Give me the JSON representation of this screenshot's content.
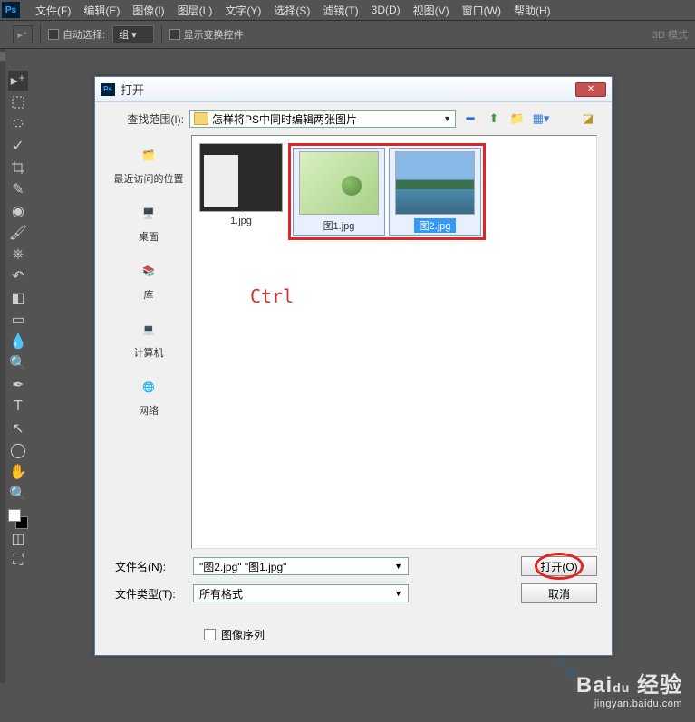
{
  "menubar": {
    "items": [
      "文件(F)",
      "编辑(E)",
      "图像(I)",
      "图层(L)",
      "文字(Y)",
      "选择(S)",
      "滤镜(T)",
      "3D(D)",
      "视图(V)",
      "窗口(W)",
      "帮助(H)"
    ]
  },
  "optionsbar": {
    "autoSelectLabel": "自动选择:",
    "autoSelectValue": "组",
    "showTransformLabel": "显示变换控件",
    "mode3d": "3D 模式"
  },
  "dialog": {
    "title": "打开",
    "lookInLabel": "查找范围(I):",
    "lookInValue": "怎样将PS中同时编辑两张图片",
    "places": {
      "recent": "最近访问的位置",
      "desktop": "桌面",
      "libraries": "库",
      "computer": "计算机",
      "network": "网络"
    },
    "files": {
      "item0": "1.jpg",
      "item1": "图1.jpg",
      "item2": "图2.jpg"
    },
    "hint": "Ctrl",
    "filenameLabel": "文件名(N):",
    "filenameValue": "\"图2.jpg\" \"图1.jpg\"",
    "filetypeLabel": "文件类型(T):",
    "filetypeValue": "所有格式",
    "openBtn": "打开(O)",
    "cancelBtn": "取消",
    "imageSequence": "图像序列"
  },
  "watermark": {
    "brand": "Bai",
    "du": "du",
    "suffix": "经验",
    "url": "jingyan.baidu.com"
  }
}
